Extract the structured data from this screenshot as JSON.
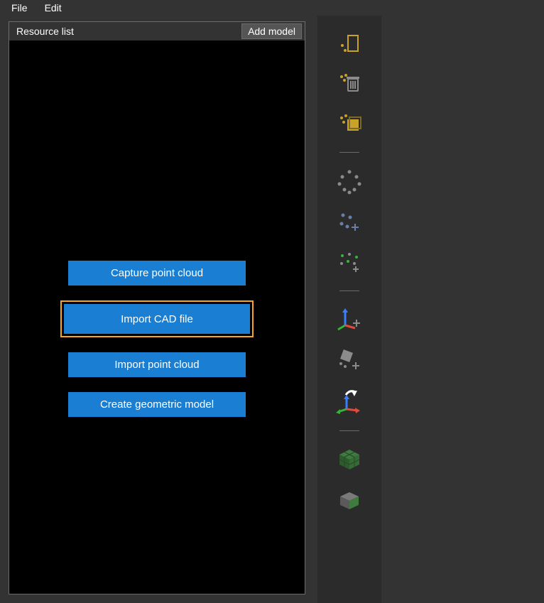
{
  "menubar": {
    "file": "File",
    "edit": "Edit"
  },
  "panel": {
    "title": "Resource list",
    "addModel": "Add model",
    "actions": {
      "capture": "Capture point cloud",
      "importCad": "Import CAD file",
      "importCloud": "Import point cloud",
      "createModel": "Create geometric model"
    },
    "selected": "importCad"
  },
  "toolbar": {
    "icons": [
      "select-points-box",
      "select-points-delete",
      "select-invert",
      "cluster-points",
      "add-points",
      "scatter-points",
      "add-frame",
      "edit-frame",
      "reset-frame",
      "voxel-green",
      "voxel-gray"
    ]
  },
  "colors": {
    "accent": "#1a7fd3",
    "highlight": "#f5a623",
    "gold": "#c9a227",
    "blueaxis": "#3a7fff",
    "greenaxis": "#35b535",
    "redaxis": "#e04b3a",
    "gray": "#8b8b8b",
    "voxelg": "#3f7a3f",
    "voxeld": "#6f6f6f"
  }
}
